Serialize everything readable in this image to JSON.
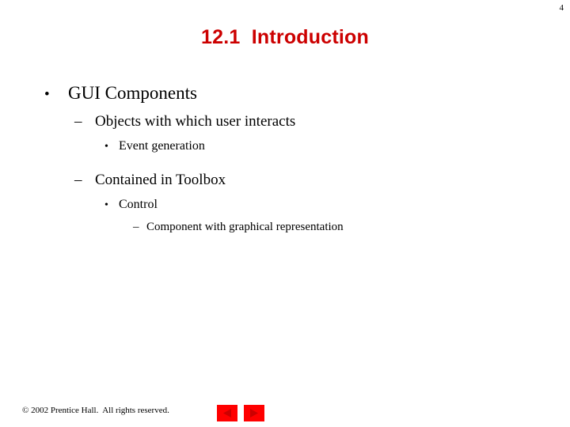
{
  "slide": {
    "page_number": "4",
    "title": "12.1  Introduction",
    "title_color": "#CC0000",
    "background_color": "#FFFFFF",
    "bullets": [
      {
        "level": 1,
        "marker": "•",
        "text": "GUI Components",
        "gap_before": false
      },
      {
        "level": 2,
        "marker": "–",
        "text": "Objects with which user interacts",
        "gap_before": false
      },
      {
        "level": 3,
        "marker": "•",
        "text": "Event generation",
        "gap_before": false
      },
      {
        "level": 2,
        "marker": "–",
        "text": "Contained in Toolbox",
        "gap_before": true
      },
      {
        "level": 3,
        "marker": "•",
        "text": "Control",
        "gap_before": false
      },
      {
        "level": 4,
        "marker": "–",
        "text": "Component with graphical representation",
        "gap_before": false
      }
    ]
  },
  "footer": {
    "copyright": "© 2002 Prentice Hall.  All rights reserved.",
    "nav": {
      "previous_label": "Previous slide",
      "next_label": "Next slide",
      "button_color": "#FF0000",
      "arrow_color": "#CC0000"
    }
  }
}
